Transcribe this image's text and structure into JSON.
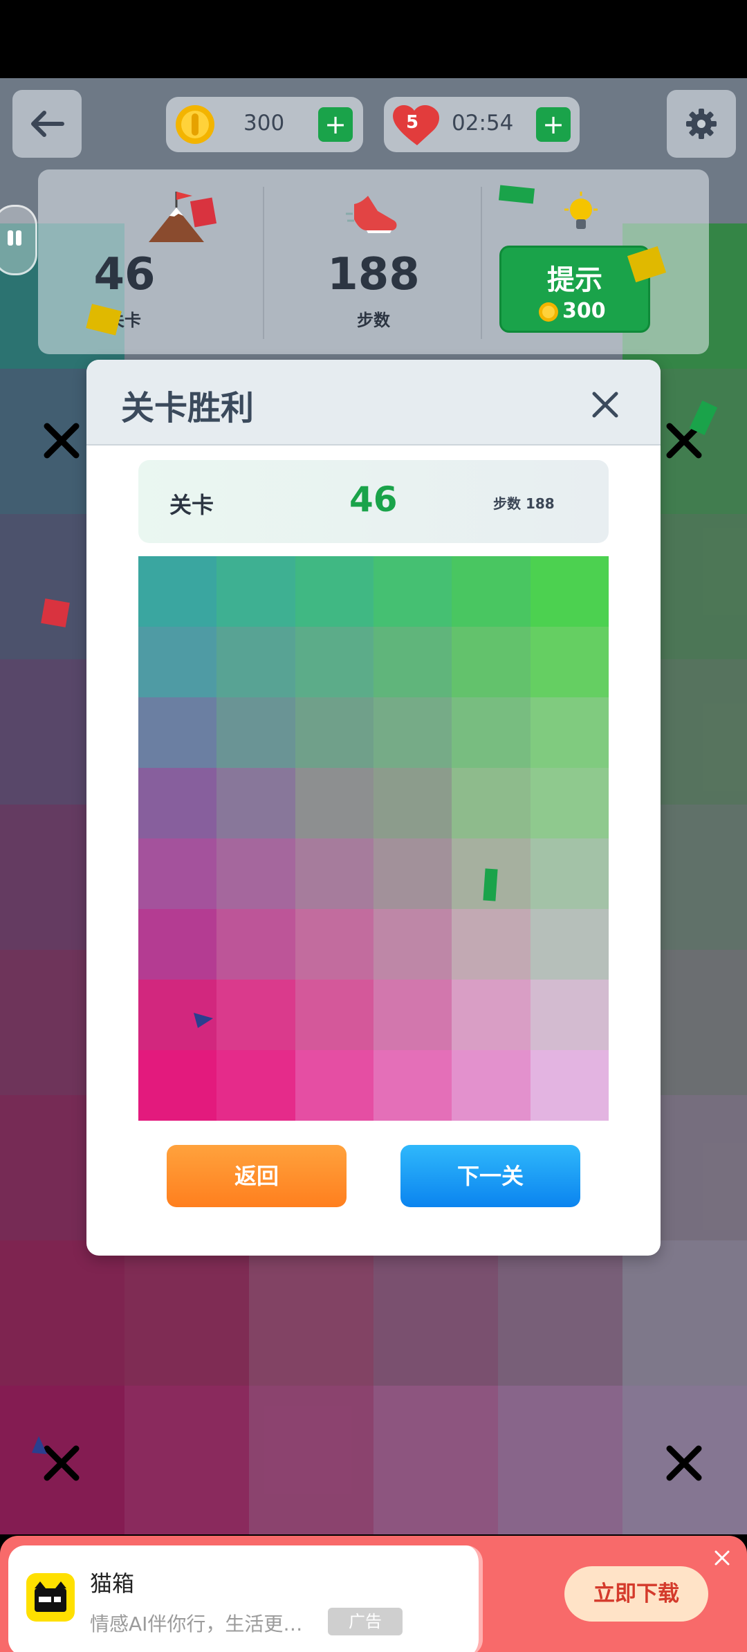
{
  "top_bar": {
    "back_icon": "arrow-left-icon",
    "coins": "300",
    "lives": "5",
    "timer": "02:54",
    "plus_label": "+",
    "settings_icon": "gear-icon"
  },
  "stats": {
    "level_value": "46",
    "level_label": "关卡",
    "steps_value": "188",
    "steps_label": "步数",
    "hint_label": "提示",
    "hint_cost": "300"
  },
  "modal": {
    "title": "关卡胜利",
    "close_icon": "close-icon",
    "info": {
      "level_label": "关卡",
      "level_value": "46",
      "steps_text": "步数 188"
    },
    "preview_grid": [
      [
        "#3aa6a0",
        "#3eb092",
        "#40b883",
        "#45c072",
        "#49c661",
        "#4cd150"
      ],
      [
        "#4f9ba4",
        "#58a394",
        "#5cac89",
        "#60b57b",
        "#63c26c",
        "#65cf62"
      ],
      [
        "#6b7fa2",
        "#6a9495",
        "#70a08a",
        "#76ab87",
        "#78bd80",
        "#80cb7f"
      ],
      [
        "#875f9d",
        "#88779a",
        "#8d8f90",
        "#8c9c8c",
        "#8ebb8c",
        "#8fc98e"
      ],
      [
        "#a4529c",
        "#a5679d",
        "#a67c9c",
        "#a2919a",
        "#a6b09f",
        "#a3c2a7"
      ],
      [
        "#b43c92",
        "#bd5598",
        "#c26c9e",
        "#be87a7",
        "#c2a9b3",
        "#b6bfba"
      ],
      [
        "#d2277e",
        "#da3a8c",
        "#d4589a",
        "#d277ad",
        "#d99ec5",
        "#d3bbd0"
      ],
      [
        "#e31a7d",
        "#e52b8a",
        "#e54ea3",
        "#e46fb8",
        "#e391cd",
        "#e3b4e1"
      ]
    ],
    "back_label": "返回",
    "next_label": "下一关"
  },
  "ad": {
    "app_name": "猫箱",
    "description": "情感AI伴你行，生活更…",
    "badge": "广告",
    "download_label": "立即下载",
    "close_icon": "close-icon"
  },
  "colors": {
    "green_button": "#1aa34a",
    "orange_button": "#ff8a25",
    "blue_button": "#1a9cf5",
    "ad_background": "#f86a6a"
  }
}
